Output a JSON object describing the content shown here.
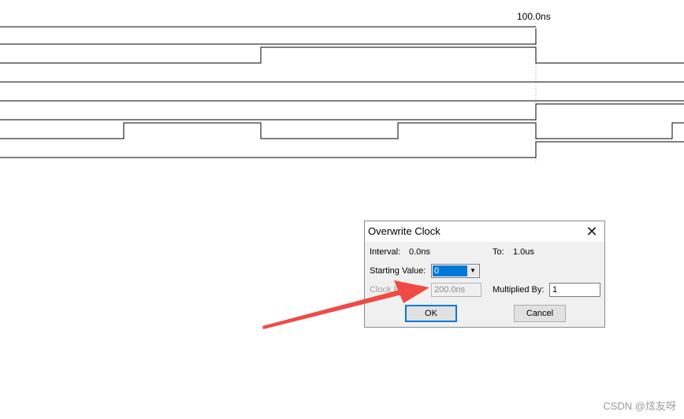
{
  "timeline": {
    "cursor_time": "100.0ns"
  },
  "dialog": {
    "title": "Overwrite Clock",
    "interval_label": "Interval:",
    "interval_value": "0.0ns",
    "to_label": "To:",
    "to_value": "1.0us",
    "starting_value_label": "Starting Value:",
    "starting_value": "0",
    "clock_period_label": "Clock Period:",
    "clock_period_value": "200.0ns",
    "multiplied_by_label": "Multiplied By:",
    "multiplied_by_value": "1",
    "ok_label": "OK",
    "cancel_label": "Cancel"
  },
  "annotation": {
    "arrow_color": "#f04a45"
  },
  "watermark": "CSDN @炫友呀"
}
